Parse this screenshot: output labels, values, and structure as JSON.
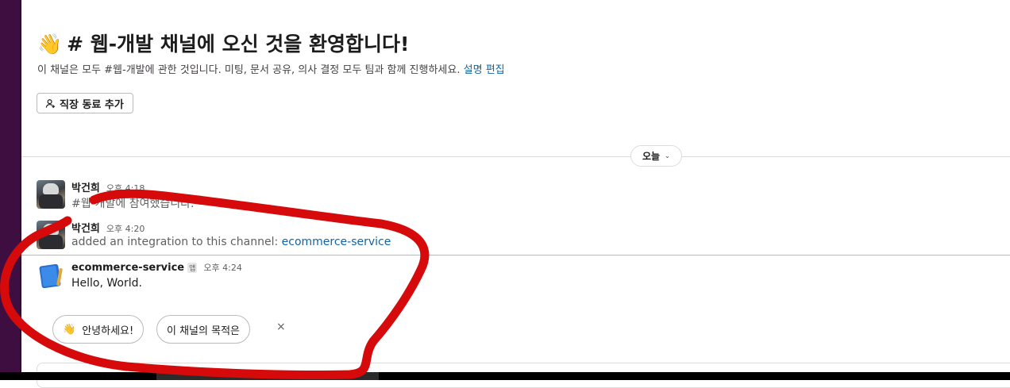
{
  "welcome": {
    "wave_emoji": "👋",
    "title": "# 웹-개발 채널에 오신 것을 환영합니다!",
    "description": "이 채널은 모두 #웹-개발에 관한 것입니다. 미팅, 문서 공유, 의사 결정 모두 팀과 함께 진행하세요.",
    "edit_description_label": "설명 편집",
    "add_coworker_label": "직장 동료 추가"
  },
  "date_divider": {
    "label": "오늘"
  },
  "messages": [
    {
      "sender": "박건희",
      "time": "오후 4:18",
      "text": "#웹-개발에 참여했습니다."
    },
    {
      "sender": "박건희",
      "time": "오후 4:20",
      "text": "added an integration to this channel: ",
      "link": "ecommerce-service"
    },
    {
      "sender": "ecommerce-service",
      "badge": "앱",
      "time": "오후 4:24",
      "text": "Hello, World."
    }
  ],
  "suggestions": [
    {
      "emoji": "👋",
      "label": "안녕하세요!"
    },
    {
      "label": "이 채널의 목적은"
    }
  ],
  "dismiss_label": "×",
  "colors": {
    "sidebar": "#3f0e40",
    "link": "#1264a3",
    "new_messages_line": "#e8a2ad",
    "annotation": "#d60a0a"
  },
  "icons": {
    "add_coworker": "person-add-icon",
    "date_chevron": "chevron-down-icon",
    "app_avatar": "notebook-icon"
  }
}
